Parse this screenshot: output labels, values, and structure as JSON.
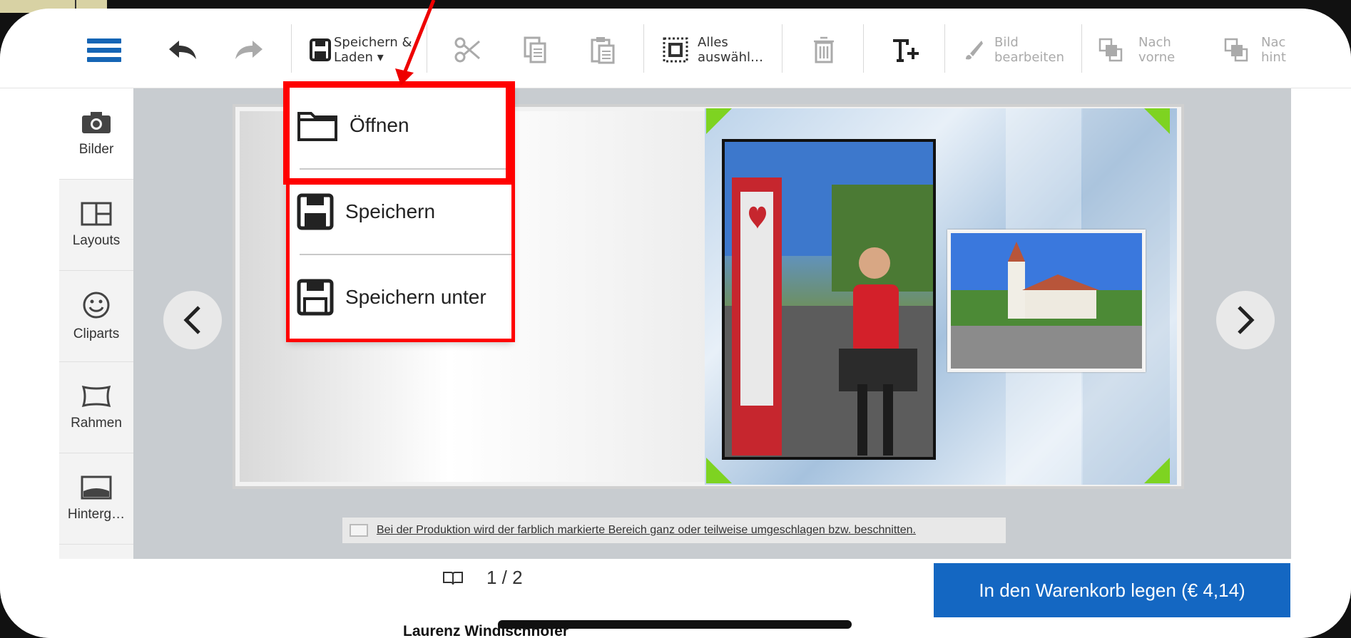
{
  "toolbar": {
    "save_load_label_1": "Speichern &",
    "save_load_label_2": "Laden ▾",
    "select_all_label_1": "Alles",
    "select_all_label_2": "auswähl…",
    "edit_image_label_1": "Bild",
    "edit_image_label_2": "bearbeiten",
    "to_front_label_1": "Nach",
    "to_front_label_2": "vorne",
    "to_back_label_1": "Nac",
    "to_back_label_2": "hint"
  },
  "sidebar": {
    "items": [
      {
        "label": "Bilder",
        "icon": "camera-icon"
      },
      {
        "label": "Layouts",
        "icon": "layout-icon"
      },
      {
        "label": "Cliparts",
        "icon": "smiley-icon"
      },
      {
        "label": "Rahmen",
        "icon": "frame-icon"
      },
      {
        "label": "Hinterg…",
        "icon": "background-icon"
      }
    ]
  },
  "dropdown": {
    "items": [
      {
        "label": "Öffnen",
        "icon": "folder-icon"
      },
      {
        "label": "Speichern",
        "icon": "floppy-icon"
      },
      {
        "label": "Speichern unter",
        "icon": "floppy-save-as-icon"
      }
    ]
  },
  "infobar": {
    "text": "Bei der Produktion wird der farblich markierte Bereich ganz oder teilweise umgeschlagen bzw. beschnitten."
  },
  "pager": {
    "current": "1 / 2"
  },
  "cart": {
    "label": "In den Warenkorb legen (€ 4,14)"
  },
  "overlay": {
    "author": "Laurenz Windischhofer"
  },
  "colors": {
    "accent": "#1467c2",
    "highlight": "#ff0000",
    "trim_marker": "#7ed321"
  }
}
